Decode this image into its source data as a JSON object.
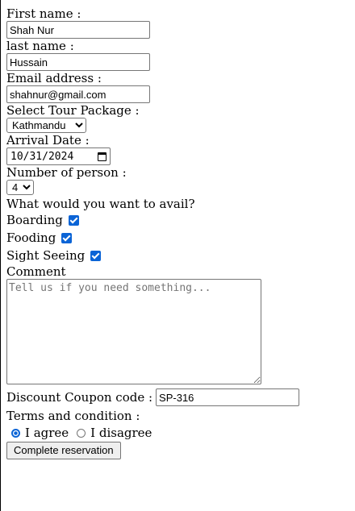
{
  "form": {
    "first_name": {
      "label": "First name :",
      "value": "Shah Nur"
    },
    "last_name": {
      "label": "last name :",
      "value": "Hussain"
    },
    "email": {
      "label": "Email address :",
      "value": "shahnur@gmail.com"
    },
    "tour_package": {
      "label": "Select Tour Package :",
      "selected": "Kathmandu"
    },
    "arrival_date": {
      "label": "Arrival Date :",
      "value": "10/31/2024"
    },
    "persons": {
      "label": "Number of person :",
      "selected": "4"
    },
    "avail": {
      "label": "What would you want to avail?",
      "options": [
        {
          "label": "Boarding",
          "checked": true
        },
        {
          "label": "Fooding",
          "checked": true
        },
        {
          "label": "Sight Seeing",
          "checked": true
        }
      ]
    },
    "comment": {
      "label": "Comment",
      "placeholder": "Tell us if you need something..."
    },
    "coupon": {
      "label": "Discount Coupon code :",
      "value": "SP-316"
    },
    "terms": {
      "label": "Terms and condition :",
      "agree_label": "I agree",
      "disagree_label": "I disagree",
      "selected": "agree"
    },
    "submit_label": "Complete reservation"
  },
  "colors": {
    "accent": "#0b64d6",
    "input_border": "#767676",
    "button_bg": "#efefef"
  }
}
